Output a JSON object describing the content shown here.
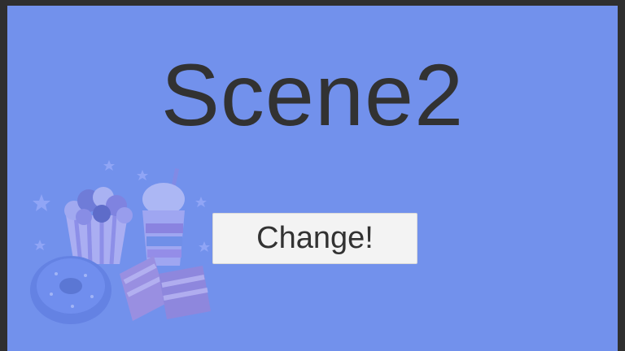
{
  "scene": {
    "title": "Scene2",
    "button_label": "Change!"
  },
  "colors": {
    "frame": "#2f2f2f",
    "background": "#7291ec",
    "text": "#323232",
    "button": "#f3f3f3"
  },
  "decoration": {
    "icon": "sweets-illustration-icon"
  }
}
